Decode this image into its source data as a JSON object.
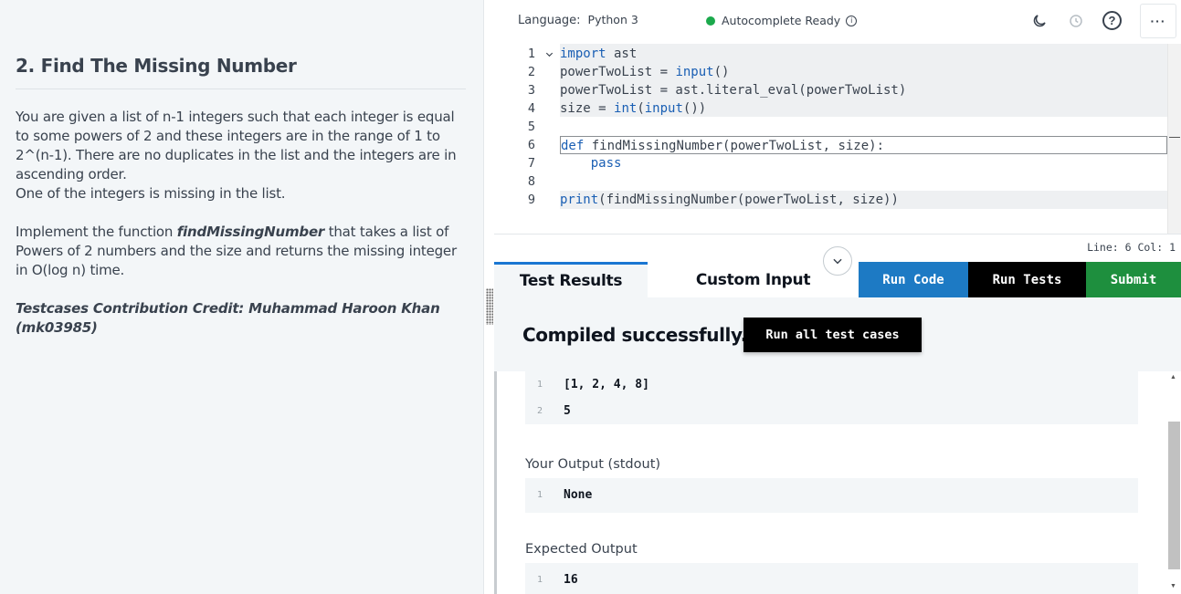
{
  "problem": {
    "title": "2. Find The Missing Number",
    "para1": "You are given a list of n-1 integers such that each integer is equal to some powers of 2 and these integers are in the range of 1 to 2^(n-1). There are no duplicates in the list and the integers are in ascending order.",
    "para2": "One of the integers is missing in the list.",
    "impl_prefix": "Implement the function ",
    "impl_fn": "findMissingNumber",
    "impl_suffix": " that takes a list of Powers of 2 numbers and the size and returns the missing integer in O(log n) time.",
    "credit": "Testcases Contribution Credit: Muhammad Haroon Khan (mk03985)"
  },
  "toolbar": {
    "language_label": "Language:",
    "language_value": "Python 3",
    "autocomplete": "Autocomplete Ready",
    "info_glyph": "i",
    "help_glyph": "?",
    "more_glyph": "···",
    "status_color": "#1ba94c"
  },
  "editor": {
    "lines": [
      {
        "n": "1",
        "text": "import ast"
      },
      {
        "n": "2",
        "text": "powerTwoList = input()"
      },
      {
        "n": "3",
        "text": "powerTwoList = ast.literal_eval(powerTwoList)"
      },
      {
        "n": "4",
        "text": "size = int(input())"
      },
      {
        "n": "5",
        "text": ""
      },
      {
        "n": "6",
        "text": "def findMissingNumber(powerTwoList, size):"
      },
      {
        "n": "7",
        "text": "    pass"
      },
      {
        "n": "8",
        "text": ""
      },
      {
        "n": "9",
        "text": "print(findMissingNumber(powerTwoList, size))"
      }
    ],
    "cursor_status": "Line: 6 Col: 1"
  },
  "tabs": {
    "test_results": "Test Results",
    "custom_input": "Custom Input"
  },
  "actions": {
    "run_code": "Run Code",
    "run_tests": "Run Tests",
    "submit": "Submit",
    "run_all": "Run all test cases"
  },
  "results": {
    "status": "Compiled successfully.",
    "input_lines": [
      {
        "n": "1",
        "text": "[1, 2, 4, 8]"
      },
      {
        "n": "2",
        "text": "5"
      }
    ],
    "your_output_label": "Your Output (stdout)",
    "your_output": [
      {
        "n": "1",
        "text": "None"
      }
    ],
    "expected_label": "Expected Output",
    "expected_output": [
      {
        "n": "1",
        "text": "16"
      }
    ]
  }
}
